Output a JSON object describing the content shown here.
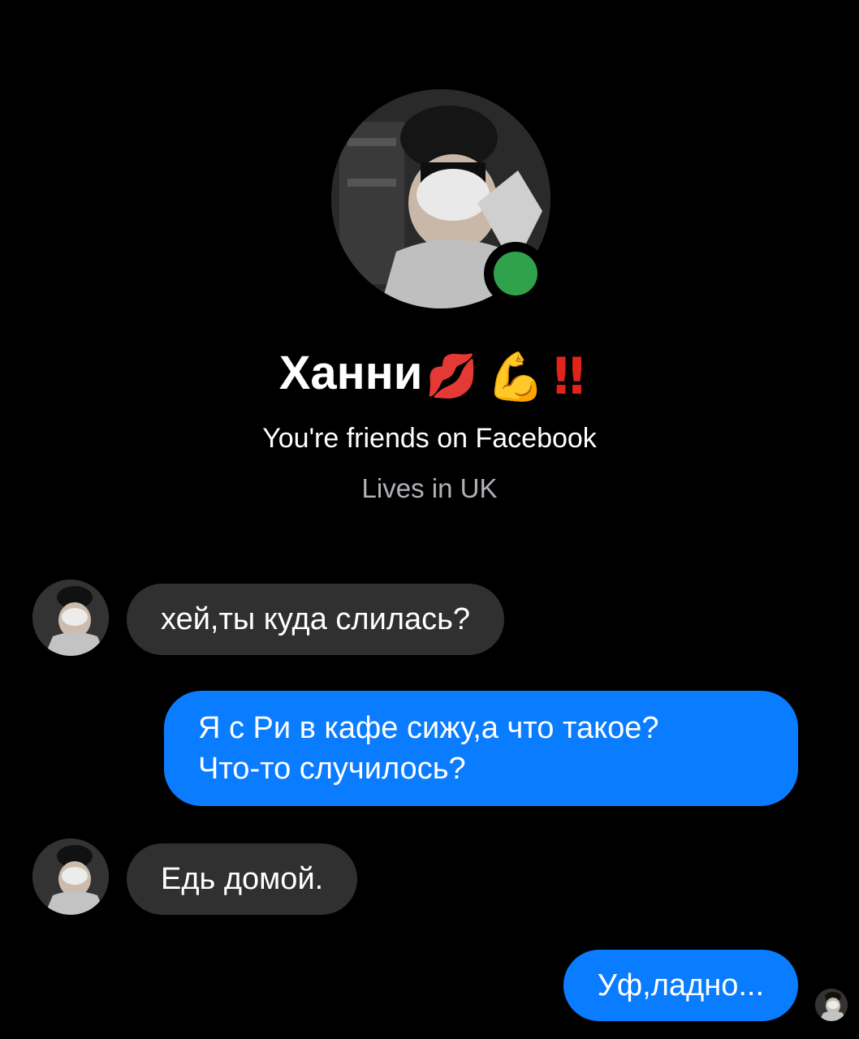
{
  "profile": {
    "avatar_icon": "profile-photo",
    "online_status_color": "#31a24c",
    "name": "Ханни",
    "name_emojis": [
      "💋",
      "💪",
      "‼"
    ],
    "friends_text": "You're friends on Facebook",
    "location_text": "Lives in UK"
  },
  "messages": [
    {
      "direction": "incoming",
      "text": "хей,ты куда слилась?"
    },
    {
      "direction": "outgoing",
      "lines": [
        "Я с Ри в кафе сижу,а что такое?",
        "Что-то случилось?"
      ]
    },
    {
      "direction": "incoming",
      "text": "Едь домой."
    },
    {
      "direction": "outgoing",
      "text": "Уф,ладно..."
    }
  ],
  "colors": {
    "background": "#000000",
    "incoming_bubble": "#303030",
    "outgoing_bubble": "#0a7cff",
    "secondary_text": "#b0b3b8"
  }
}
